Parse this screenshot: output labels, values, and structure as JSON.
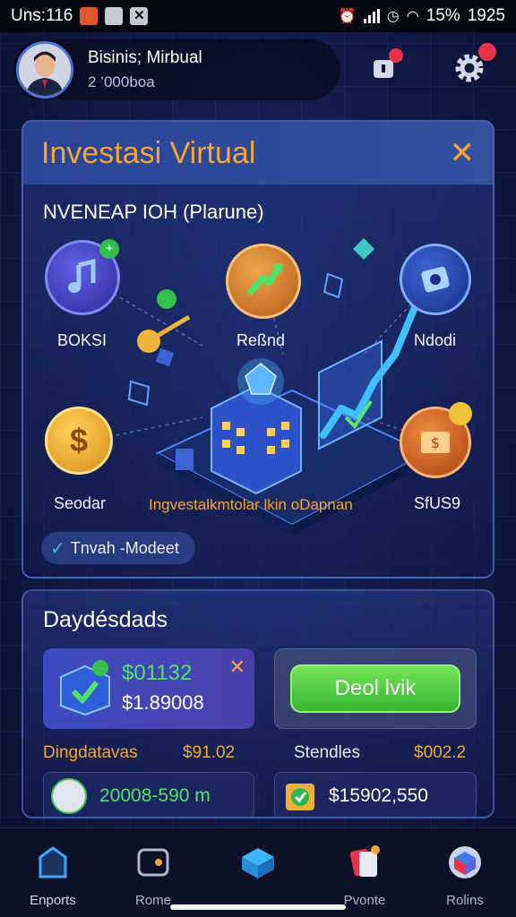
{
  "status_bar": {
    "left_text": "Uns:116",
    "battery": "15%",
    "time": "1925"
  },
  "header": {
    "name": "Bisinis; Mirbual",
    "subtitle": "2 ’000boa"
  },
  "main_card": {
    "title": "Investasi Virtual",
    "close_label": "✕",
    "subtitle": "NVENEAP IOH (Plarune)",
    "nodes": [
      {
        "label": "BOKSI",
        "icon": "music-note-icon",
        "color": "#4a4ac8"
      },
      {
        "label": "Reßnd",
        "icon": "growth-arrow-icon",
        "color": "#d07a2a"
      },
      {
        "label": "Ndodi",
        "icon": "shield-icon",
        "color": "#2c4ba8"
      },
      {
        "label": "Seodar",
        "icon": "dollar-coin-icon",
        "color": "#e8a326"
      },
      {
        "label": "SfUS9",
        "icon": "money-bill-icon",
        "color": "#c95a22"
      }
    ],
    "center_label": "Ingvestalkmtolar lkin oDapnan",
    "badge_label": "Tnvah -Modeet"
  },
  "payments_card": {
    "title": "Daydésdads",
    "tile_left": {
      "amount_primary": "$01132",
      "amount_secondary": "$1.89008",
      "close_label": "✕"
    },
    "button_label": "Deol lvik",
    "row": [
      {
        "label": "Dingdatavas",
        "value": "$91.02"
      },
      {
        "label": "Stendles",
        "value": "$002.2"
      }
    ],
    "bottom_left_value": "20008-590 m",
    "bottom_right_value": "$15902,550"
  },
  "nav": {
    "items": [
      {
        "label": "Enports",
        "icon": "home-icon",
        "active": true
      },
      {
        "label": "Rome",
        "icon": "wallet-icon",
        "active": false
      },
      {
        "label": "",
        "icon": "box-icon",
        "active": false
      },
      {
        "label": "Pvonte",
        "icon": "cards-icon",
        "active": false
      },
      {
        "label": "Rolins",
        "icon": "cube-icon",
        "active": false
      }
    ]
  },
  "colors": {
    "accent_orange": "#f5a531",
    "accent_green": "#4fe36c",
    "alert_red": "#e8324a",
    "nav_active": "#3fa5ff"
  }
}
